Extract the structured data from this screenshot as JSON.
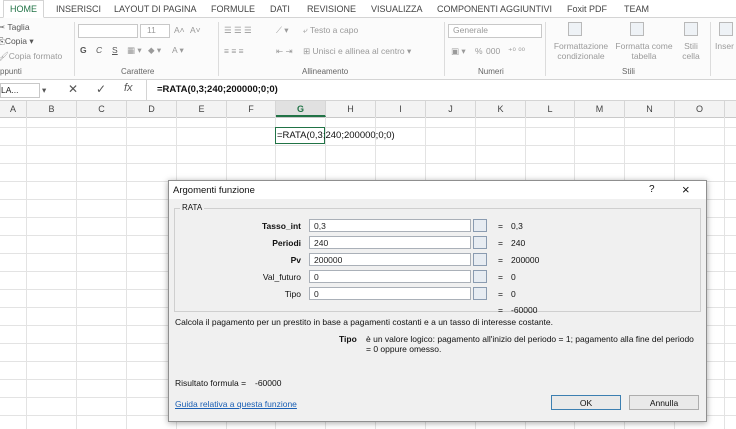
{
  "ribbon": {
    "tabs": [
      "HOME",
      "INSERISCI",
      "LAYOUT DI PAGINA",
      "FORMULE",
      "DATI",
      "REVISIONE",
      "VISUALIZZA",
      "COMPONENTI AGGIUNTIVI",
      "Foxit PDF",
      "TEAM"
    ],
    "clipboard": {
      "cut": "Taglia",
      "copy": "Copia",
      "format_painter": "Copia formato",
      "group": "ppunti"
    },
    "font": {
      "size": "11",
      "group": "Carattere",
      "bold": "G",
      "italic": "C",
      "underline": "S"
    },
    "alignment": {
      "wrap": "Testo a capo",
      "merge": "Unisci e allinea al centro",
      "group": "Allineamento"
    },
    "numbers": {
      "format": "Generale",
      "percent": "%",
      "thousands": "000",
      "group": "Numeri"
    },
    "styles": {
      "conditional": "Formattazione condizionale",
      "as_table": "Formatta come tabella",
      "cell_styles": "Stili cella",
      "group": "Stili"
    },
    "cells": {
      "insert": "Inser"
    }
  },
  "formula_bar": {
    "name_box": "LA...",
    "fx": "fx",
    "formula": "=RATA(0,3;240;200000;0;0)"
  },
  "columns": [
    "A",
    "B",
    "C",
    "D",
    "E",
    "F",
    "G",
    "H",
    "I",
    "J",
    "K",
    "L",
    "M",
    "N",
    "O"
  ],
  "cell_text": "=RATA(0,3;240;200000;0;0)",
  "dialog": {
    "title": "Argomenti funzione",
    "help_glyph": "?",
    "close_glyph": "×",
    "function_name": "RATA",
    "args": [
      {
        "label": "Tasso_int",
        "value": "0,3",
        "result": "0,3",
        "bold": true
      },
      {
        "label": "Periodi",
        "value": "240",
        "result": "240",
        "bold": true
      },
      {
        "label": "Pv",
        "value": "200000",
        "result": "200000",
        "bold": true
      },
      {
        "label": "Val_futuro",
        "value": "0",
        "result": "0",
        "bold": false
      },
      {
        "label": "Tipo",
        "value": "0",
        "result": "0",
        "bold": false
      }
    ],
    "equals": "=",
    "total_result": "-60000",
    "description": "Calcola il pagamento per un prestito in base a pagamenti costanti e a un tasso di interesse costante.",
    "arg_help_name": "Tipo",
    "arg_help_text": "è un valore logico: pagamento all'inizio del periodo = 1; pagamento alla fine del periodo = 0 oppure omesso.",
    "formula_result_label": "Risultato formula =",
    "formula_result_value": "-60000",
    "help_link": "Guida relativa a questa funzione",
    "ok": "OK",
    "cancel": "Annulla"
  }
}
